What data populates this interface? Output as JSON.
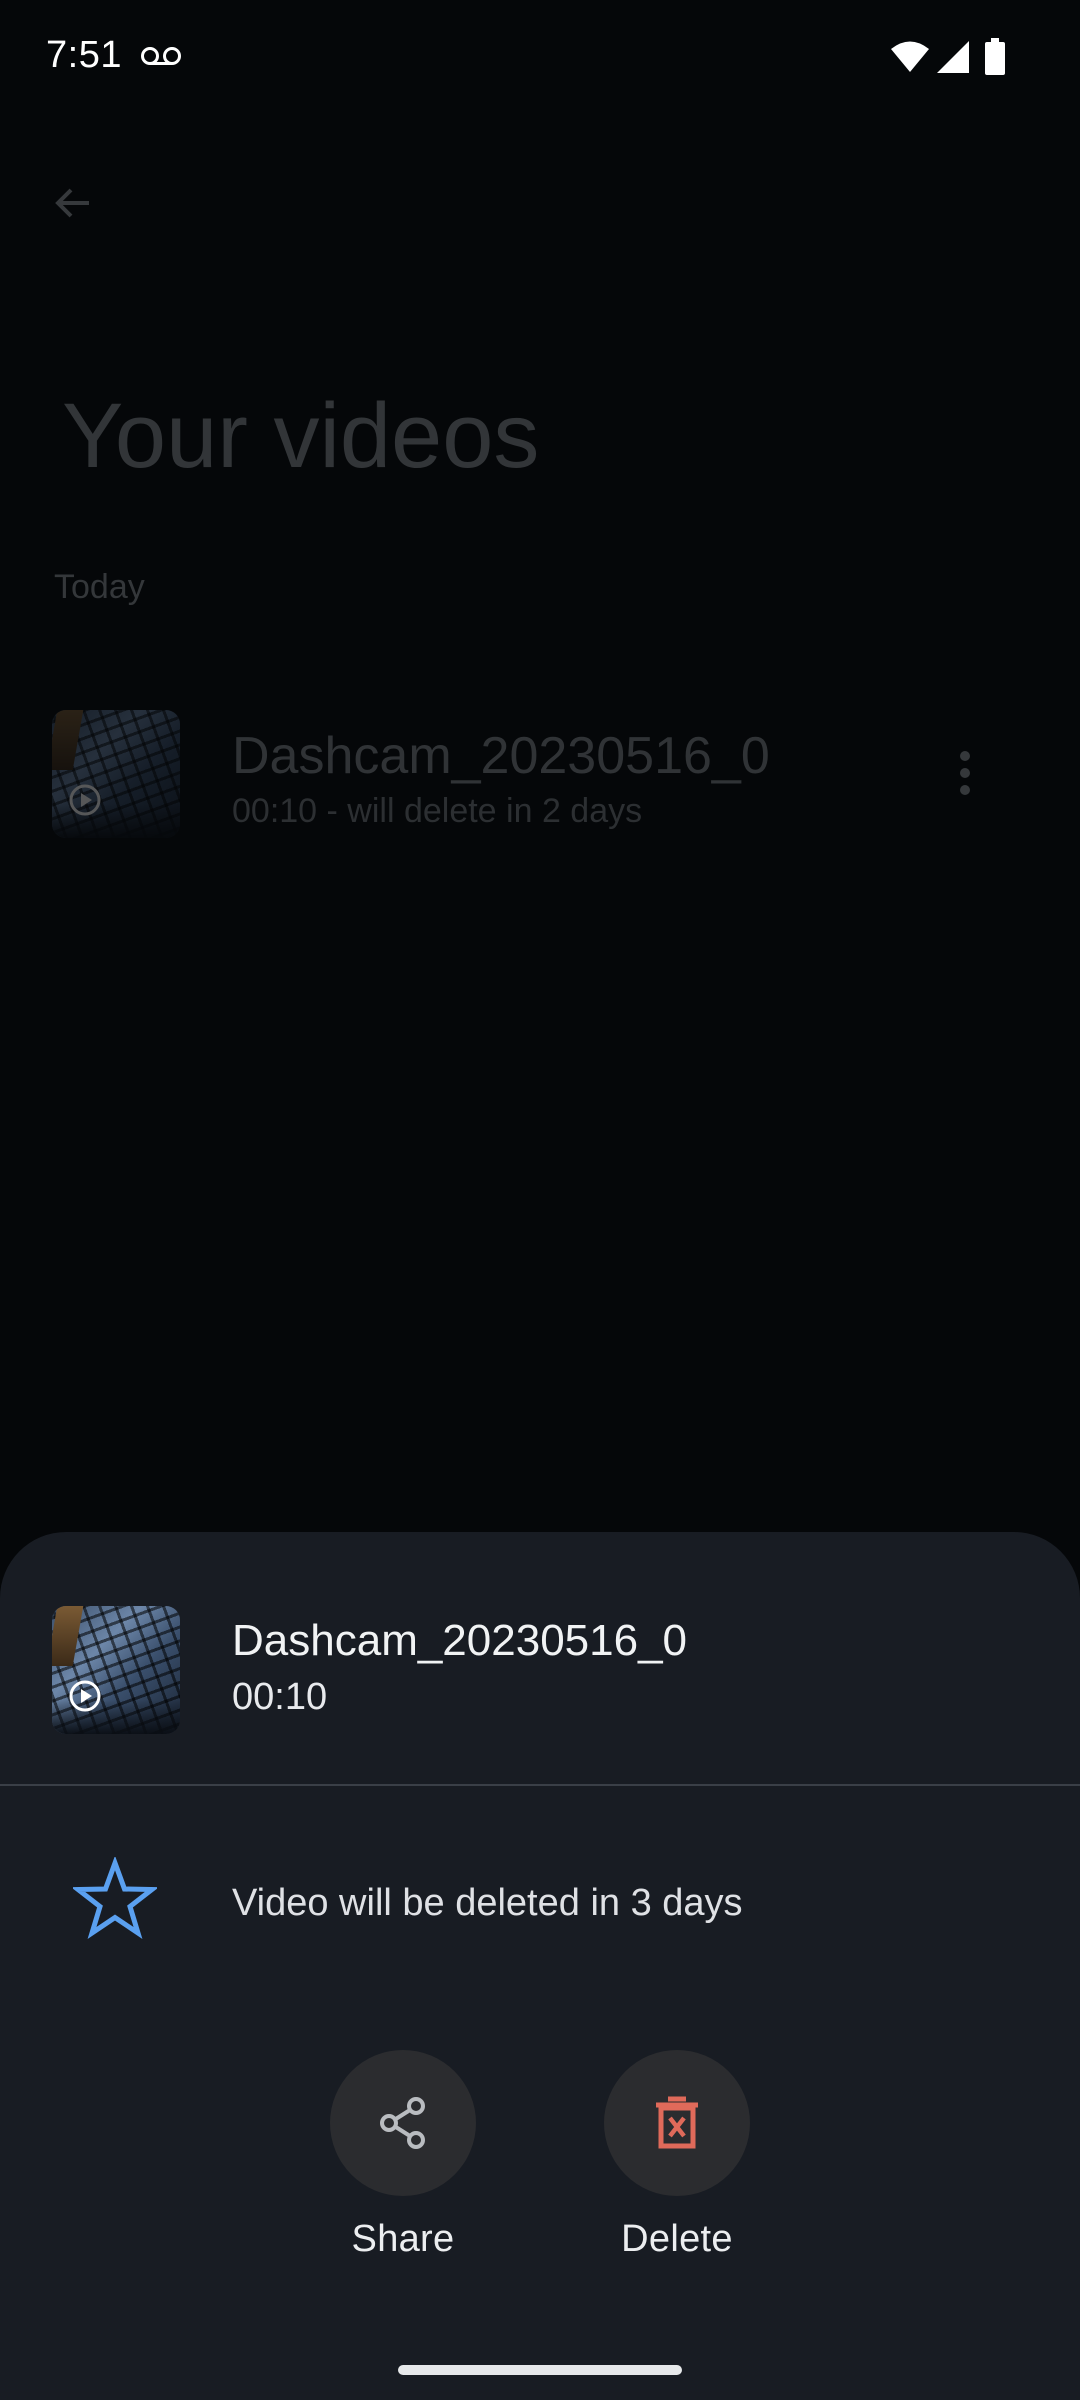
{
  "status_bar": {
    "time": "7:51",
    "icons": [
      "voicemail-icon",
      "wifi-icon",
      "cellular-signal-icon",
      "battery-icon"
    ]
  },
  "background_page": {
    "back_icon": "arrow-back-icon",
    "title": "Your videos",
    "section_label": "Today",
    "video": {
      "title": "Dashcam_20230516_0",
      "subtitle": "00:10 - will delete in 2 days",
      "thumbnail_icon": "play-circle-icon",
      "menu_icon": "more-vert-icon"
    }
  },
  "bottom_sheet": {
    "video_title": "Dashcam_20230516_0",
    "duration": "00:10",
    "retention_icon": "star-outline-icon",
    "retention_text": "Video will be deleted in 3 days",
    "actions": [
      {
        "label": "Share",
        "icon": "share-icon"
      },
      {
        "label": "Delete",
        "icon": "delete-icon"
      }
    ]
  },
  "colors": {
    "sheet_background": "#181c23",
    "star_accent": "#5aa0f0",
    "delete_accent": "#e06a5a",
    "action_circle": "#2b2c2f"
  }
}
